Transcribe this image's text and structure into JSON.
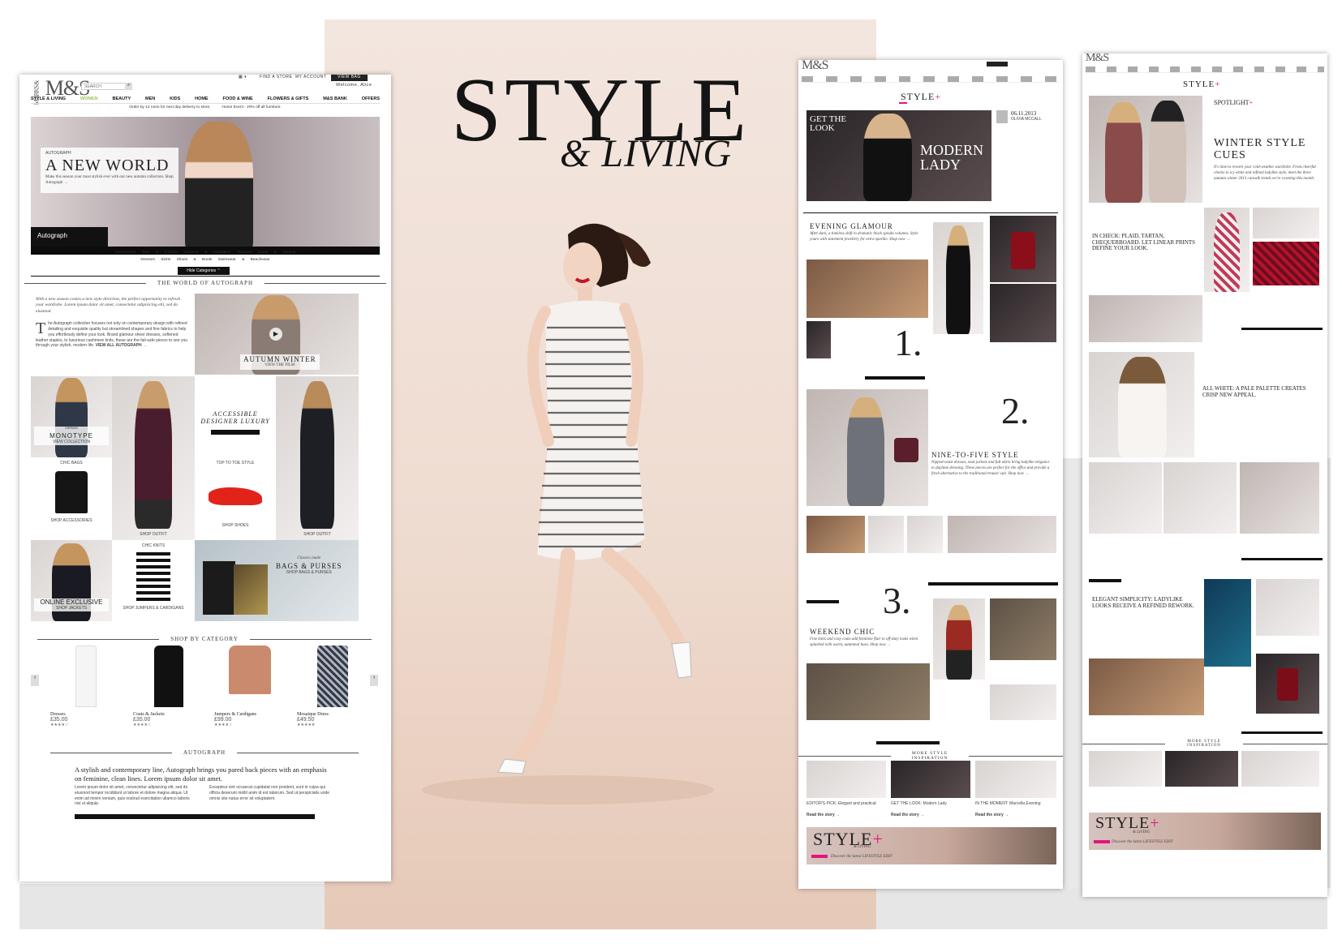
{
  "hero": {
    "title": "STYLE",
    "subtitle": "& LIVING"
  },
  "panel1": {
    "logo": "M&S",
    "logo_small": "MARKS &",
    "search_placeholder": "SEARCH",
    "top_links": [
      "FIND A STORE",
      "MY ACCOUNT"
    ],
    "view_bag": "VIEW BAG",
    "welcome": "Welcome, Alice",
    "nav": [
      "STYLE & LIVING",
      "WOMEN",
      "BEAUTY",
      "MEN",
      "KIDS",
      "HOME",
      "FOOD & WINE",
      "FLOWERS & GIFTS",
      "M&S BANK",
      "OFFERS"
    ],
    "promo": [
      "Order by 12 noon for next day delivery to store.",
      "Home Event - 20% off all furniture."
    ],
    "banner": {
      "kicker": "AUTOGRAPH",
      "title": "A NEW WORLD",
      "body": "Make this season your most stylish ever with our new autumn collection. Shop Autograph →",
      "tab": "Autograph"
    },
    "categories_row1": [
      "Accessories",
      "Tops & T-Shirts",
      "Jumpers & Cardigans",
      "Trousers",
      "Coats & Jackets"
    ],
    "categories_row2": [
      "Dresses",
      "Skirts",
      "Shoes & Boots",
      "Swimwear & Beachwear"
    ],
    "hide_categories": "Hide Categories",
    "world_head": "THE WORLD OF AUTOGRAPH",
    "world_intro": "With a new season comes a new style direction, the perfect opportunity to refresh your wardrobe. Lorem ipsum dolor sit amet, consectetur adipisicing elit, sed do eiusmod.",
    "world_body": "he Autograph collection focuses not only on contemporary design with refined detailing and exquisite quality but streamlined shapes and fine fabrics to help you effortlessly define your look. Brand glamour sheer dresses, softened leather staples, to luxurious cashmere knits, these are the fail-safe pieces to see you through your stylish, modern life.",
    "world_dropcap": "T",
    "view_all": "VIEW ALL AUTOGRAPH →",
    "autumn_winter": "AUTUMN WINTER",
    "view_film": "VIEW THE FILM",
    "dresses_label": "Dresses",
    "monotype": "MONOTYPE",
    "view_collection": "VIEW COLLECTION",
    "accessible_luxury": "ACCESSIBLE DESIGNER LUXURY",
    "chic_bags": "CHIC BAGS",
    "shop_accessories": "SHOP ACCESSORIES",
    "shop_outfit": "SHOP OUTFIT",
    "top_to_toe": "TOP TO TOE STYLE",
    "shop_shoes": "SHOP SHOES",
    "online_exclusive": "ONLINE EXCLUSIVE",
    "shop_jackets": "SHOP JACKETS",
    "chic_knits": "CHIC KNITS",
    "shop_knits": "SHOP JUMPERS & CARDIGANS",
    "bags_kicker": "Classics made",
    "bags_title": "BAGS & PURSES",
    "shop_bags": "SHOP BAGS & PURSES",
    "shop_by_category": "SHOP BY CATEGORY",
    "products": [
      {
        "name": "Dresses",
        "price": "£35.00",
        "stars": "★★★★☆"
      },
      {
        "name": "Coats & Jackets",
        "price": "£35.00",
        "stars": "★★★★☆"
      },
      {
        "name": "Jumpers & Cardigans",
        "price": "£99.00",
        "stars": "★★★★☆"
      },
      {
        "name": "Mosaique Dress",
        "price": "£49.50",
        "stars": "★★★★★"
      }
    ],
    "autograph_head": "AUTOGRAPH",
    "autograph_intro": "A stylish and contemporary line, Autograph brings you pared back pieces with an emphasis on feminine, clean lines. Lorem ipsum dolor sit amet.",
    "lorem_left": "Lorem ipsum dolor sit amet, consectetur adipisicing elit, sed do eiusmod tempor incididunt ut labore et dolore magna aliqua. Ut enim ad minim veniam, quis nostrud exercitation ullamco laboris nisi ut aliquip.",
    "lorem_right": "Excepteur sint occaecat cupidatat non proident, sunt in culpa qui officia deserunt mollit anim id est laborum. Sed ut perspiciatis unde omnis iste natus error sit voluptatem."
  },
  "panel2": {
    "logo": "M&S",
    "masthead": "STYLE",
    "get_the_look": "GET THE LOOK",
    "modern_lady": "MODERN LADY",
    "date": "06.11.2013",
    "author": "OLIVIA MCCALL",
    "glamour_title": "EVENING GLAMOUR",
    "glamour_body": "After dark, a timeless shift in dramatic black speaks volumes. Style yours with statement jewellery for extra sparkle. Shop now →",
    "num1": "1.",
    "num2": "2.",
    "num3": "3.",
    "nine_five_title": "NINE-TO-FIVE STYLE",
    "nine_five_body": "Nipped-waist dresses, neat jackets and full skirts bring ladylike elegance to daytime dressing. These pieces are perfect for the office and provide a fresh alternative to the traditional trouser suit. Shop now →",
    "weekend_title": "WEEKEND CHIC",
    "weekend_body": "Fine knits and cosy coats add feminine flair to off-duty looks when splashed with warm, autumnal hues. Shop now →",
    "more_inspiration": "MORE STYLE INSPIRATION",
    "insp": [
      "EDITOR'S PICK: Elegant and practical",
      "GET THE LOOK: Modern Lady",
      "IN THE MOMENT: Marcella Evening"
    ],
    "read_story": "Read the story →",
    "footer_title": "STYLE",
    "footer_sub": "& LIVING",
    "footer_tag": "Discover the latest LIFESTYLE EDIT"
  },
  "panel3": {
    "logo": "M&S",
    "masthead": "STYLE",
    "spotlight": "SPOTLIGHT",
    "winter_title": "WINTER STYLE CUES",
    "winter_body": "It's time to rework your cold-weather wardrobe. From cheerful checks to icy white and refined ladylike style, meet the three autumn winter 2013 catwalk trends we're coveting this month.",
    "check_title": "IN CHECK: PLAID, TARTAN, CHEQUERBOARD. LET LINEAR PRINTS DEFINE YOUR LOOK.",
    "allwhite_title": "ALL WHITE: A PALE PALETTE CREATES CRISP NEW APPEAL.",
    "elegant_title": "ELEGANT SIMPLICITY: LADYLIKE LOOKS RECEIVE A REFINED REWORK.",
    "more_inspiration": "MORE STYLE INSPIRATION",
    "footer_title": "STYLE",
    "footer_sub": "& LIVING",
    "footer_tag": "Discover the latest LIFESTYLE EDIT"
  },
  "colors": {
    "accent_green": "#9cc35a",
    "pink": "#e5157b",
    "black": "#111111"
  }
}
